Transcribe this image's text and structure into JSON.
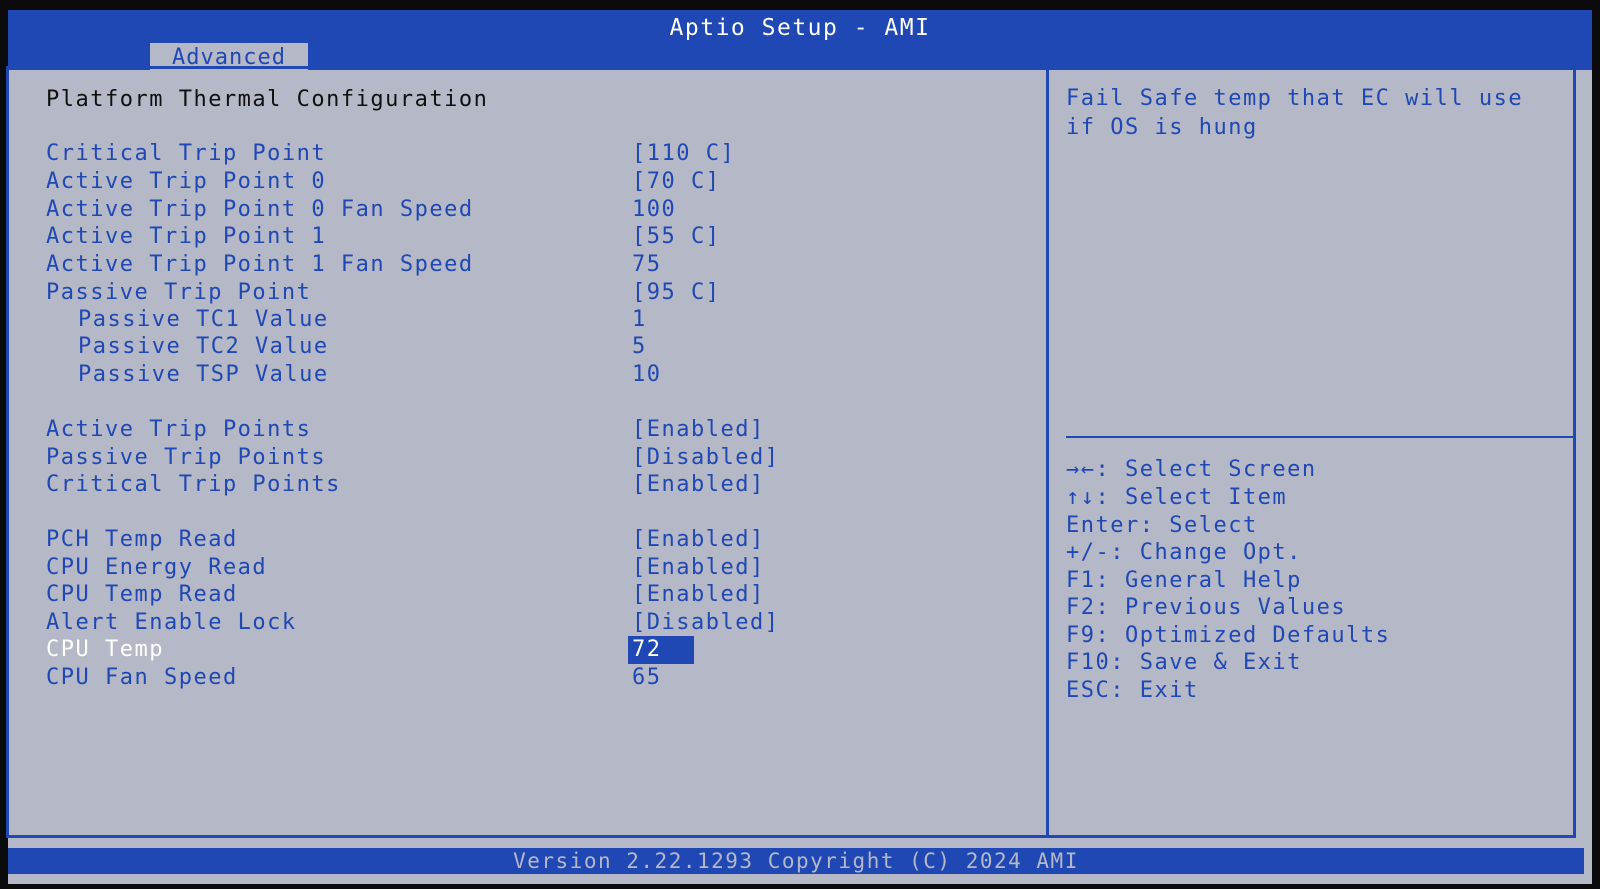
{
  "header": {
    "title": "Aptio Setup - AMI",
    "tab": "Advanced"
  },
  "main": {
    "section_title": "Platform Thermal Configuration",
    "settings": [
      {
        "label": "Critical Trip Point",
        "value": "[110 C]"
      },
      {
        "label": "Active Trip Point 0",
        "value": "[70 C]"
      },
      {
        "label": "Active Trip Point 0 Fan Speed",
        "value": "100"
      },
      {
        "label": "Active Trip Point 1",
        "value": "[55 C]"
      },
      {
        "label": "Active Trip Point 1 Fan Speed",
        "value": "75"
      },
      {
        "label": "Passive Trip Point",
        "value": "[95 C]"
      },
      {
        "label": "Passive TC1 Value",
        "value": "1"
      },
      {
        "label": "Passive TC2 Value",
        "value": "5"
      },
      {
        "label": "Passive TSP Value",
        "value": "10"
      },
      {
        "label": "Active Trip Points",
        "value": "[Enabled]"
      },
      {
        "label": "Passive Trip Points",
        "value": "[Disabled]"
      },
      {
        "label": "Critical Trip Points",
        "value": "[Enabled]"
      },
      {
        "label": "PCH Temp Read",
        "value": "[Enabled]"
      },
      {
        "label": "CPU Energy Read",
        "value": "[Enabled]"
      },
      {
        "label": "CPU Temp Read",
        "value": "[Enabled]"
      },
      {
        "label": "Alert Enable Lock",
        "value": "[Disabled]"
      },
      {
        "label": "CPU Temp",
        "value": "72"
      },
      {
        "label": "CPU Fan Speed",
        "value": "65"
      }
    ]
  },
  "help": {
    "text": "Fail Safe temp that EC will use if OS is hung"
  },
  "keys": [
    "→←: Select Screen",
    "↑↓: Select Item",
    "Enter: Select",
    "+/-: Change Opt.",
    "F1: General Help",
    "F2: Previous Values",
    "F9: Optimized Defaults",
    "F10: Save & Exit",
    "ESC: Exit"
  ],
  "footer": {
    "text": "Version 2.22.1293 Copyright (C) 2024 AMI"
  },
  "colors": {
    "background": "#b5b8c6",
    "accent": "#1f48b4",
    "highlight_text": "#ffffff",
    "section_text": "#101010"
  }
}
